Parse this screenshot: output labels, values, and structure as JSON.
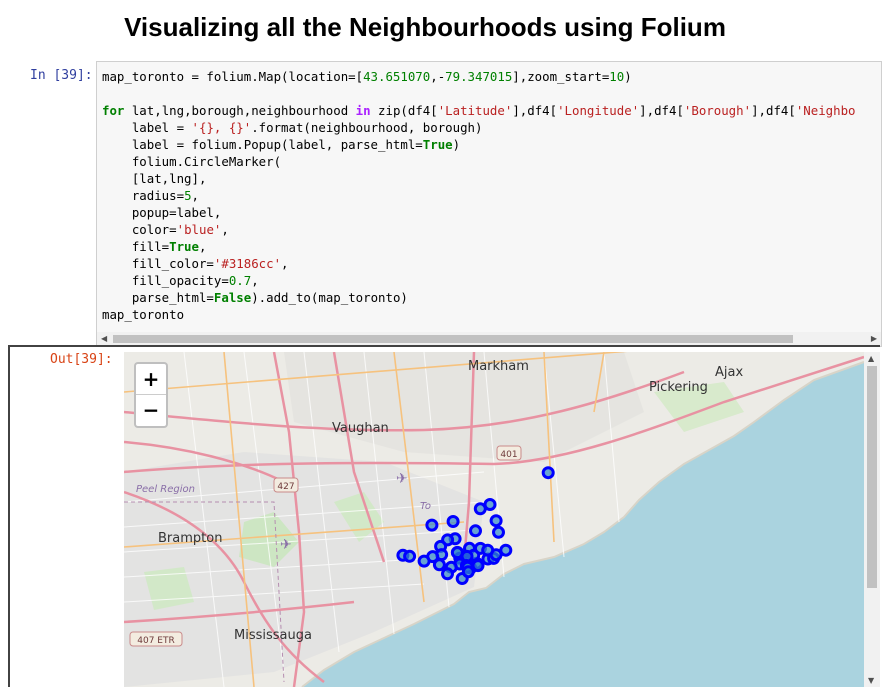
{
  "page": {
    "heading": "Visualizing all the Neighbourhoods using Folium",
    "in_prompt": "In [39]:",
    "out_prompt": "Out[39]:"
  },
  "code": {
    "line1": {
      "a": "map_toronto = folium.Map(location=[",
      "n1": "43.651070",
      "c": ",-",
      "n2": "79.347015",
      "d": "],zoom_start=",
      "n3": "10",
      "e": ")"
    },
    "line3": {
      "kw1": "for",
      "a": " lat,lng,borough,neighbourhood ",
      "kw2": "in",
      "b": " zip(df4[",
      "s1": "'Latitude'",
      "c": "],df4[",
      "s2": "'Longitude'",
      "d": "],df4[",
      "s3": "'Borough'",
      "e": "],df4[",
      "s4": "'Neighbo"
    },
    "line4": {
      "a": "    label = ",
      "s1": "'{}, {}'",
      "b": ".format(neighbourhood, borough)"
    },
    "line5": {
      "a": "    label = folium.Popup(label, parse_html=",
      "kw": "True",
      "b": ")"
    },
    "line6": "    folium.CircleMarker(",
    "line7": "    [lat,lng],",
    "line8": {
      "a": "    radius=",
      "n": "5",
      "b": ","
    },
    "line9": "    popup=label,",
    "line10": {
      "a": "    color=",
      "s": "'blue'",
      "b": ","
    },
    "line11": {
      "a": "    fill=",
      "kw": "True",
      "b": ","
    },
    "line12": {
      "a": "    fill_color=",
      "s": "'#3186cc'",
      "b": ","
    },
    "line13": {
      "a": "    fill_opacity=",
      "n": "0.7",
      "b": ","
    },
    "line14": {
      "a": "    parse_html=",
      "kw": "False",
      "b": ").add_to(map_toronto)"
    },
    "line15": "map_toronto"
  },
  "map": {
    "zoom_in": "+",
    "zoom_out": "−",
    "place_labels": [
      "Markham",
      "Pickering",
      "Ajax",
      "Vaughan",
      "Brampton",
      "Mississauga",
      "Peel Region",
      "To"
    ],
    "highway_shields": [
      "401",
      "427",
      "407 ETR"
    ],
    "colors": {
      "water": "#aad3df",
      "marker_stroke": "#0000ff",
      "marker_fill": "#3186cc",
      "road": "#e892a2"
    },
    "markers": [
      [
        43.7532,
        -79.3297
      ],
      [
        43.7259,
        -79.3156
      ],
      [
        43.6543,
        -79.3606
      ],
      [
        43.7185,
        -79.4648
      ],
      [
        43.6623,
        -79.3895
      ],
      [
        43.6679,
        -79.5322
      ],
      [
        43.8067,
        -79.1944
      ],
      [
        43.7459,
        -79.3522
      ],
      [
        43.7064,
        -79.3099
      ],
      [
        43.6571,
        -79.3789
      ],
      [
        43.709,
        -79.3635
      ],
      [
        43.6509,
        -79.3845
      ],
      [
        43.7247,
        -79.4156
      ],
      [
        43.6955,
        -79.4109
      ],
      [
        43.6937,
        -79.4282
      ],
      [
        43.6727,
        -79.4056
      ],
      [
        43.6627,
        -79.4
      ],
      [
        43.6532,
        -79.4
      ],
      [
        43.6289,
        -79.3944
      ],
      [
        43.6464,
        -79.3748
      ],
      [
        43.6486,
        -79.3799
      ],
      [
        43.6616,
        -79.3345
      ],
      [
        43.6764,
        -79.293
      ],
      [
        43.6796,
        -79.3775
      ],
      [
        43.668,
        -79.3677
      ],
      [
        43.6484,
        -79.3802
      ],
      [
        43.6659,
        -79.3832
      ],
      [
        43.6506,
        -79.3846
      ],
      [
        43.6478,
        -79.3819
      ],
      [
        43.6401,
        -79.3802
      ],
      [
        43.6626,
        -79.3213
      ],
      [
        43.6689,
        -79.3155
      ],
      [
        43.6479,
        -79.4198
      ],
      [
        43.6368,
        -79.4285
      ],
      [
        43.6723,
        -79.4056
      ],
      [
        43.6828,
        -79.4445
      ],
      [
        43.669,
        -79.4423
      ],
      [
        43.6519,
        -79.4475
      ],
      [
        43.6656,
        -79.463
      ],
      [
        43.6795,
        -79.352
      ],
      [
        43.658,
        -79.483
      ],
      [
        43.6662,
        -79.5166
      ],
      [
        43.6764,
        -79.335
      ],
      [
        43.6505,
        -79.3576
      ]
    ]
  }
}
